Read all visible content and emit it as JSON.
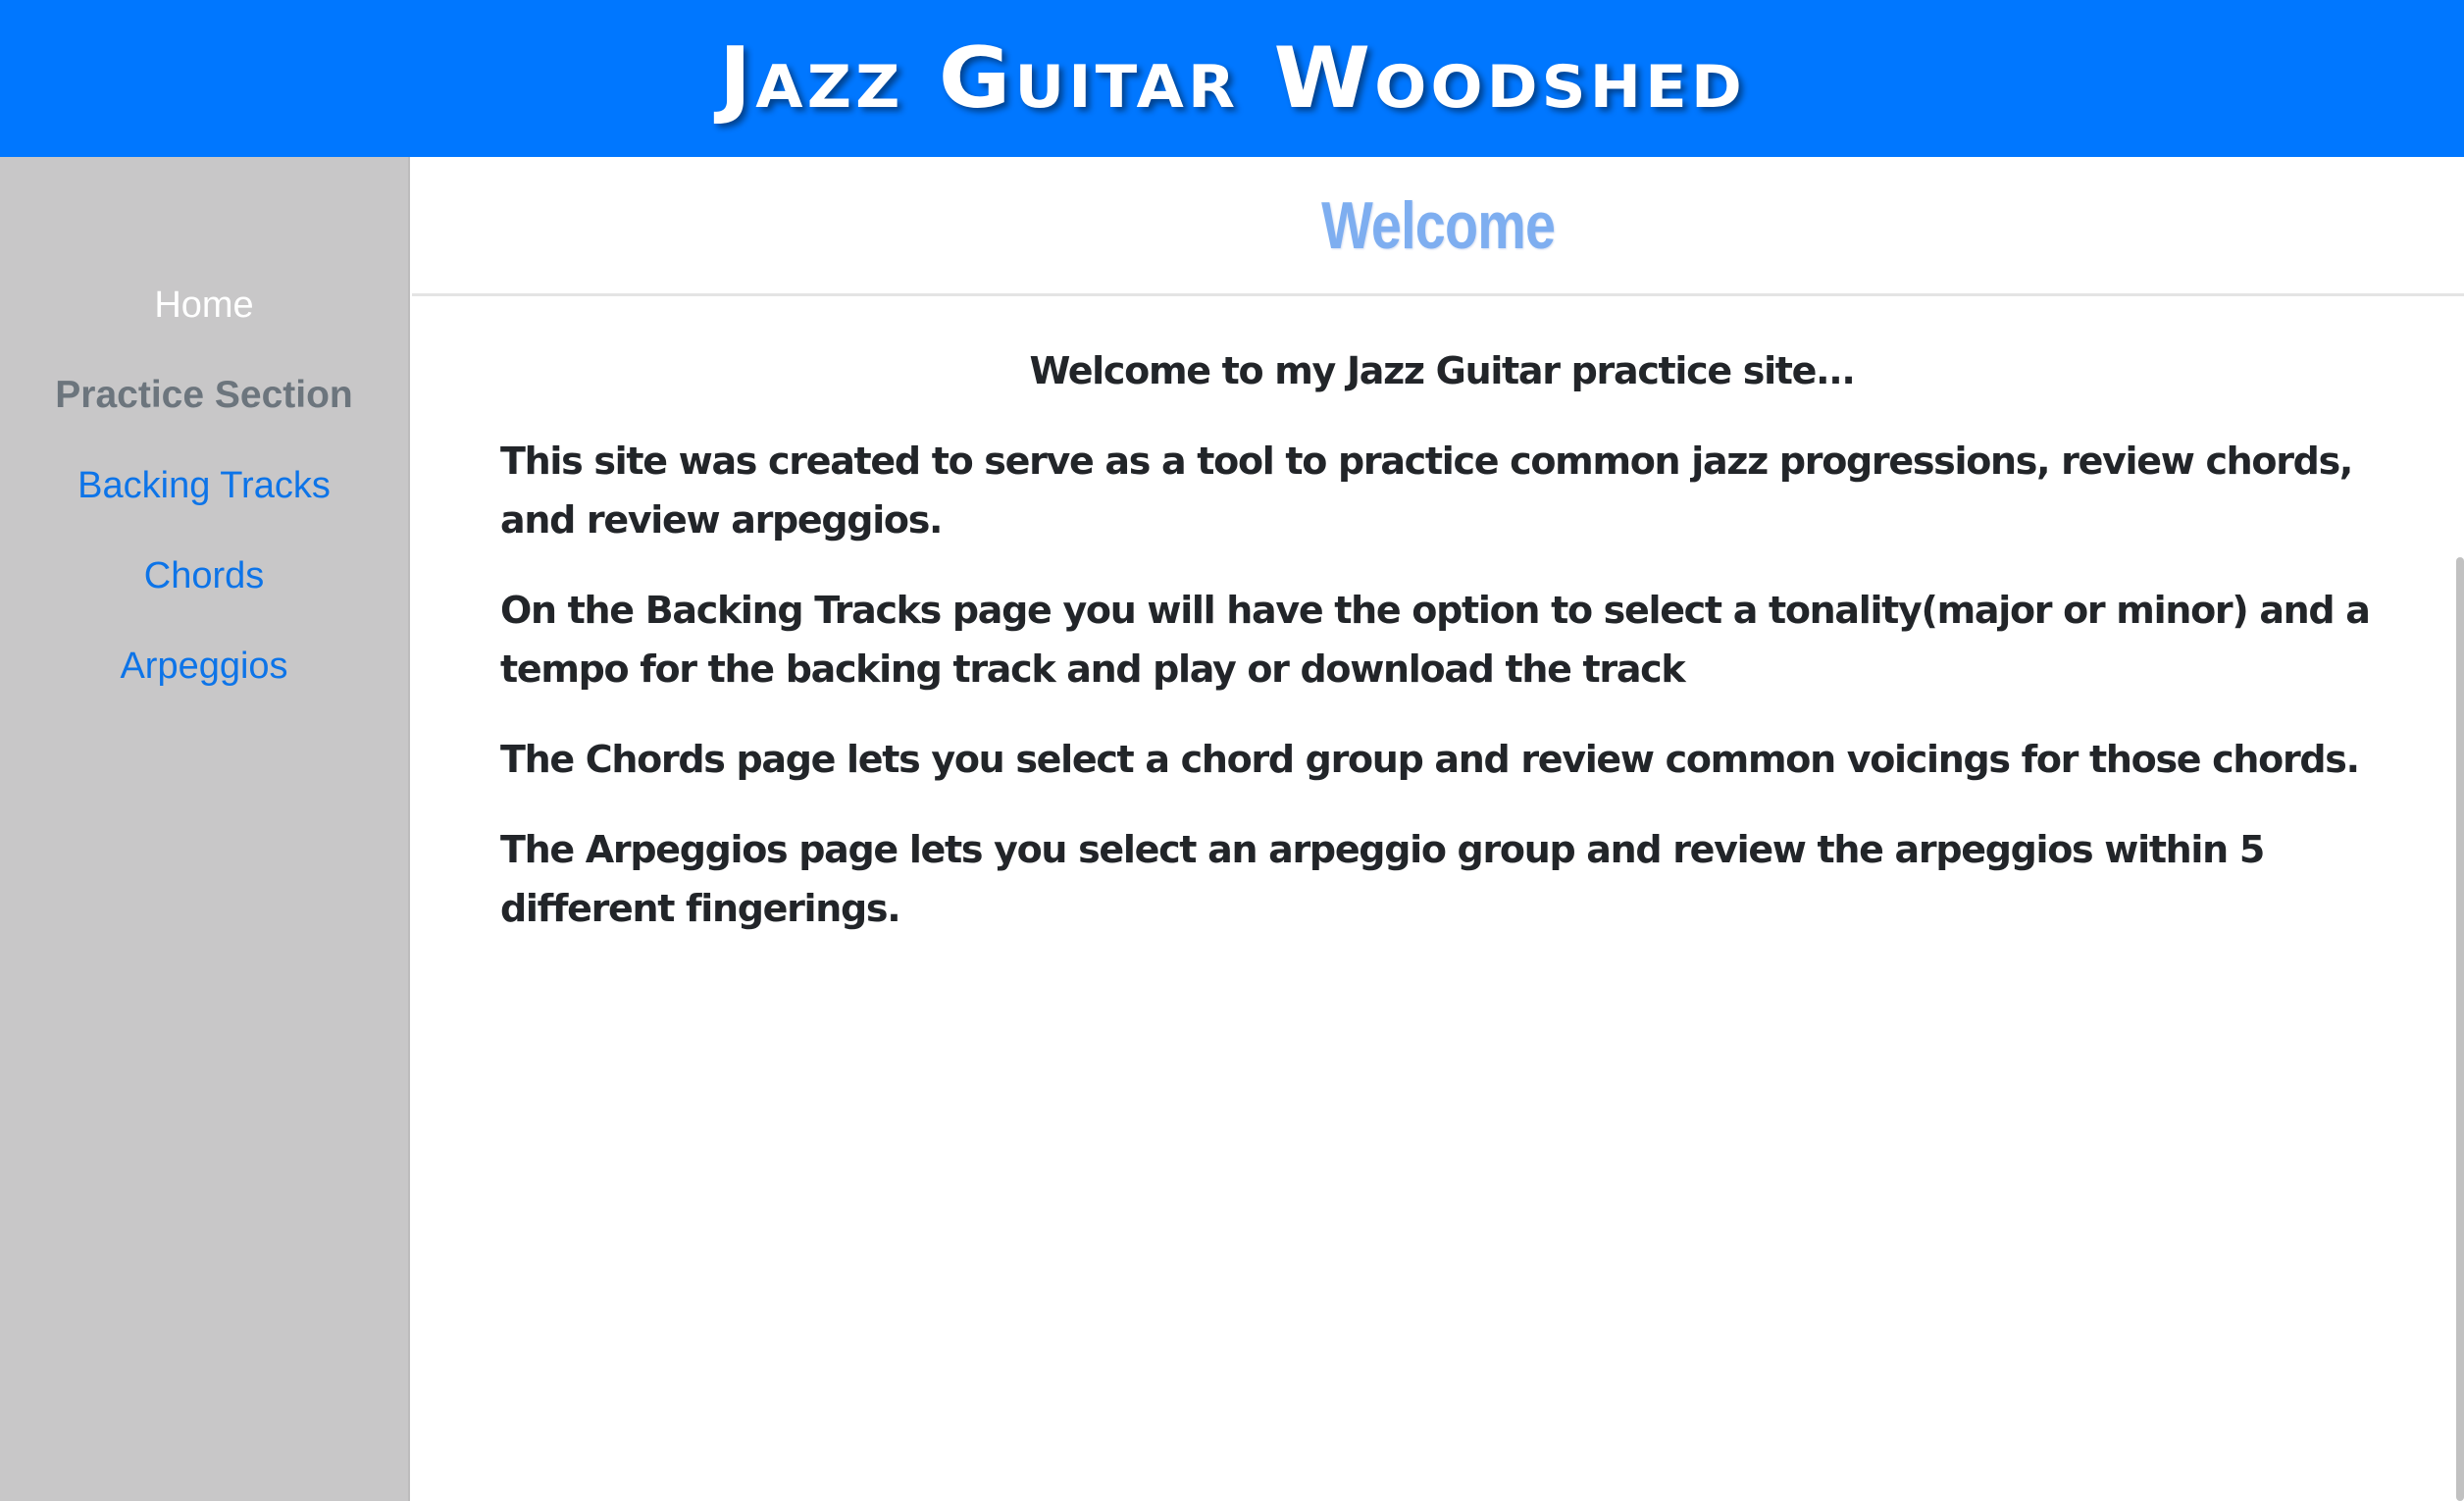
{
  "header": {
    "title": "Jazz Guitar Woodshed"
  },
  "sidebar": {
    "items": [
      {
        "label": "Home"
      },
      {
        "label": "Practice Section"
      },
      {
        "label": "Backing Tracks"
      },
      {
        "label": "Chords"
      },
      {
        "label": "Arpeggios"
      }
    ]
  },
  "main": {
    "heading": "Welcome",
    "intro": "Welcome to my Jazz Guitar practice site...",
    "paragraphs": [
      "This site was created to serve as a tool to practice common jazz progressions, review chords, and review arpeggios.",
      "On the Backing Tracks page you will have the option to select a tonality(major or minor) and a tempo for the backing track and play or download the track",
      "The Chords page lets you select a chord group and review common voicings for those chords.",
      "The Arpeggios page lets you select an arpeggio group and review the arpeggios within 5 different fingerings."
    ]
  },
  "colors": {
    "header_bg": "#0077ff",
    "sidebar_bg": "#c8c7c8",
    "link": "#0d74e8",
    "heading": "#7eaef0",
    "text": "#222529"
  }
}
